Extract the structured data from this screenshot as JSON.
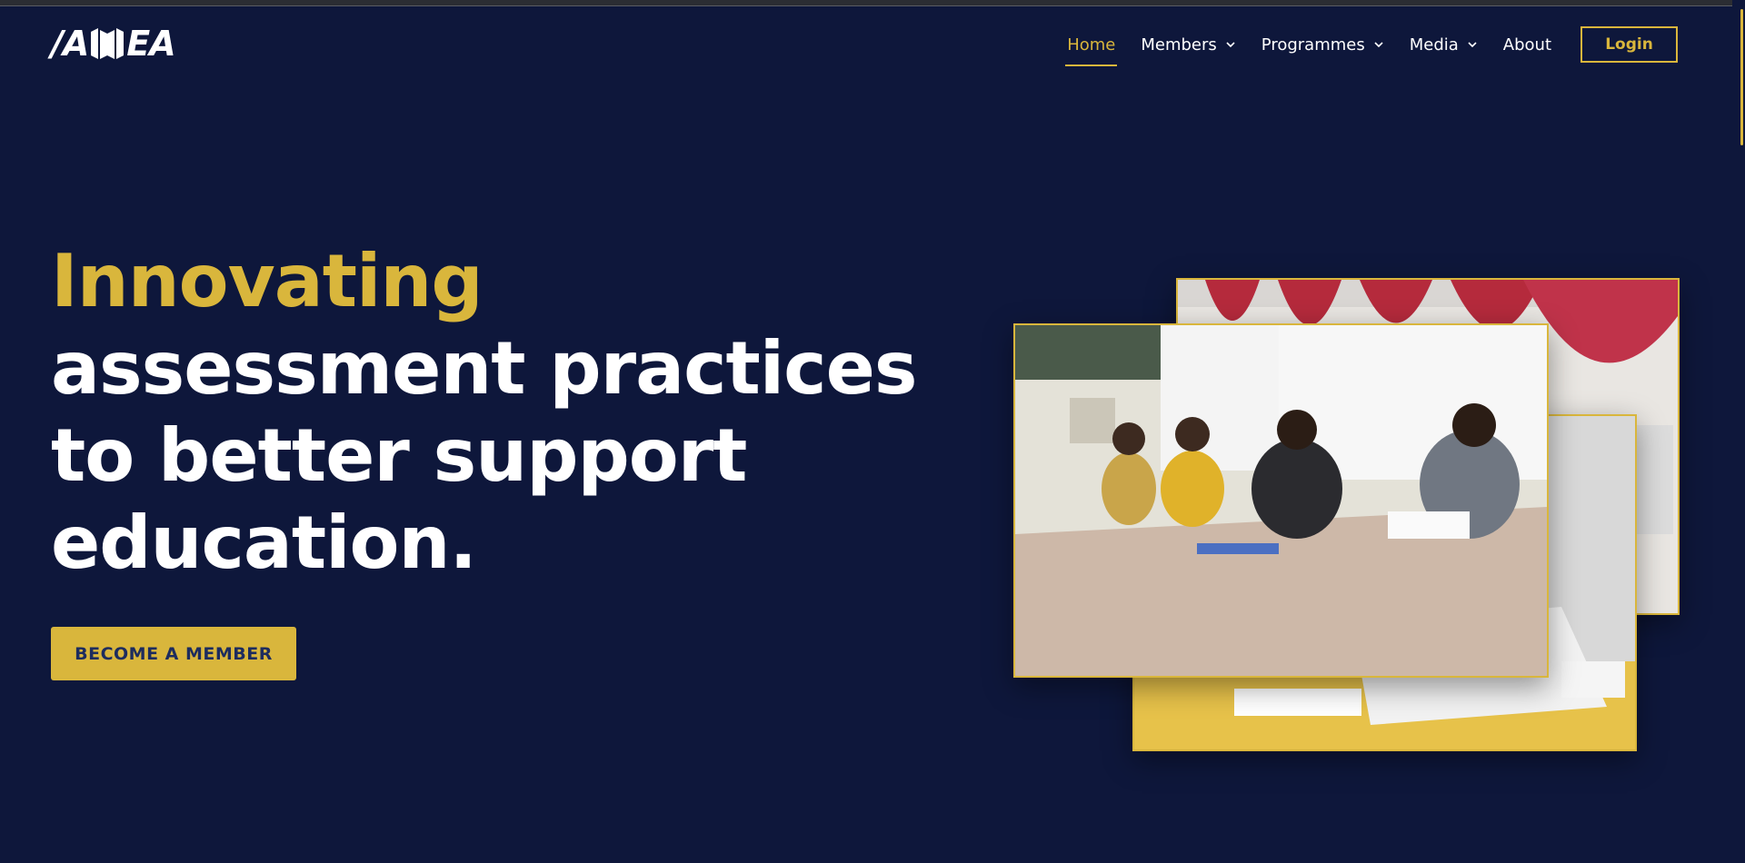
{
  "brand": {
    "logo_text_left": "/A",
    "logo_text_right": "EA"
  },
  "nav": {
    "items": [
      {
        "label": "Home",
        "active": true,
        "dropdown": false
      },
      {
        "label": "Members",
        "active": false,
        "dropdown": true
      },
      {
        "label": "Programmes",
        "active": false,
        "dropdown": true
      },
      {
        "label": "Media",
        "active": false,
        "dropdown": true
      },
      {
        "label": "About",
        "active": false,
        "dropdown": false
      }
    ],
    "login_label": "Login"
  },
  "hero": {
    "line1": "Innovating",
    "line2": "assessment practices",
    "line3": "to better support",
    "line4": "education.",
    "cta_label": "BECOME A MEMBER"
  },
  "colors": {
    "background": "#0e173b",
    "accent": "#d9b63c",
    "text": "#ffffff",
    "cta_text": "#1d2c5e"
  }
}
